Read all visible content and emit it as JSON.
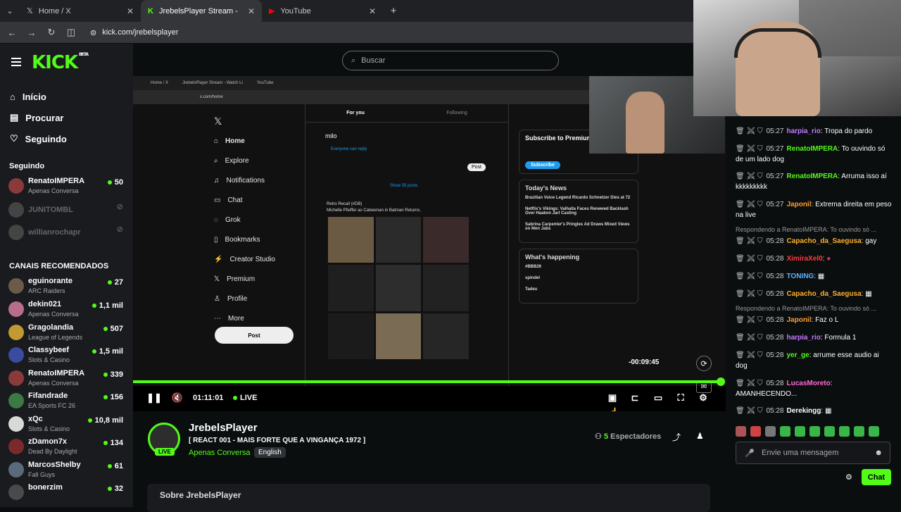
{
  "browser": {
    "tabs": [
      {
        "label": "Home / X",
        "icon": "x-logo-icon"
      },
      {
        "label": "JrebelsPlayer Stream - Watch Li",
        "icon": "kick-logo-icon"
      },
      {
        "label": "YouTube",
        "icon": "youtube-icon"
      }
    ],
    "url": "kick.com/jrebelsplayer"
  },
  "kick": {
    "logo": "KICK",
    "beta": "BETA",
    "search_placeholder": "Buscar",
    "nav": [
      {
        "label": "Início",
        "icon": "home-icon"
      },
      {
        "label": "Procurar",
        "icon": "browse-icon"
      },
      {
        "label": "Seguindo",
        "icon": "heart-icon"
      }
    ],
    "following_title": "Seguindo",
    "following": [
      {
        "name": "RenatoIMPERA",
        "category": "Apenas Conversa",
        "viewers": "50"
      },
      {
        "name": "JUNITOMBL",
        "category": "",
        "viewers": ""
      },
      {
        "name": "willianrochapr",
        "category": "",
        "viewers": ""
      }
    ],
    "recommended_title": "CANAIS RECOMENDADOS",
    "recommended": [
      {
        "name": "eguinorante",
        "category": "ARC Raiders",
        "viewers": "27"
      },
      {
        "name": "dekin021",
        "category": "Apenas Conversa",
        "viewers": "1,1 mil"
      },
      {
        "name": "Gragolandia",
        "category": "League of Legends",
        "viewers": "507"
      },
      {
        "name": "Classybeef",
        "category": "Slots & Casino",
        "viewers": "1,5 mil"
      },
      {
        "name": "RenatoIMPERA",
        "category": "Apenas Conversa",
        "viewers": "339"
      },
      {
        "name": "Fifandrade",
        "category": "EA Sports FC 26",
        "viewers": "156"
      },
      {
        "name": "xQc",
        "category": "Slots & Casino",
        "viewers": "10,8 mil"
      },
      {
        "name": "zDamon7x",
        "category": "Dead By Daylight",
        "viewers": "134"
      },
      {
        "name": "MarcosShelby",
        "category": "Fall Guys",
        "viewers": "61"
      },
      {
        "name": "bonerzim",
        "category": "",
        "viewers": "32"
      }
    ]
  },
  "stream_content": {
    "x_nav": [
      "Home",
      "Explore",
      "Notifications",
      "Chat",
      "Grok",
      "Bookmarks",
      "Creator Studio",
      "Premium",
      "Profile",
      "More"
    ],
    "x_post": "Post",
    "x_tabs": [
      "For you",
      "Following"
    ],
    "x_compose_user": "milo",
    "x_reply_setting": "Everyone can reply",
    "x_show_posts": "Show 35 posts",
    "x_tweet_author": "Retro Recall (#DB)",
    "x_tweet_text": "Michelle Pfeiffer as Catwoman in Batman Returns.",
    "x_subscribe_title": "Subscribe to Premium",
    "x_subscribe_btn": "Subscribe",
    "x_news_title": "Today's News",
    "x_news": [
      "Brazilian Voice Legend Ricardo Schnetzer Dies at 72",
      "Netflix's Vikings: Valhalla Faces Renewed Backlash Over Haakon Jarl Casting",
      "Sabrina Carpenter's Pringles Ad Draws Mixed Views on Men Jabs"
    ],
    "x_happening_title": "What's happening",
    "x_happening": [
      "#BBB26",
      "spindel",
      "Tadeu"
    ]
  },
  "player": {
    "time_left": "-00:09:45",
    "elapsed": "01:11:01",
    "live_label": "LIVE",
    "progress": 1.0
  },
  "stream_info": {
    "streamer": "JrebelsPlayer",
    "live_badge": "LIVE",
    "title": "[ REACT 001 - MAIS FORTE QUE A VINGANÇA 1972 ]",
    "category": "Apenas Conversa",
    "language": "English",
    "viewers_count": "5",
    "viewers_label": "Espectadores",
    "about": "Sobre JrebelsPlayer"
  },
  "chat": {
    "messages": [
      {
        "time": "05:27",
        "user": "harpia_rio",
        "color": "#c27cff",
        "text": "Tropa do pardo"
      },
      {
        "time": "05:27",
        "user": "RenatoIMPERA",
        "color": "#53fc18",
        "text": "To ouvindo só de um lado dog"
      },
      {
        "time": "05:27",
        "user": "RenatoIMPERA",
        "color": "#53fc18",
        "text": "Arruma isso aí kkkkkkkkk"
      },
      {
        "time": "05:27",
        "user": "Japonil",
        "color": "#ff9d2e",
        "text": "Extrema direita em peso na live"
      },
      {
        "time": "05:28",
        "user": "Capacho_da_Saegusa",
        "color": "#ffb02e",
        "text": "gay"
      },
      {
        "time": "05:28",
        "user": "XimiraXel0",
        "color": "#ff3b3b",
        "text": ""
      },
      {
        "time": "05:28",
        "user": "TONING",
        "color": "#5ab4ff",
        "text": ""
      },
      {
        "time": "05:28",
        "user": "Capacho_da_Saegusa",
        "color": "#ffb02e",
        "text": ""
      },
      {
        "time": "05:28",
        "user": "Japonil",
        "color": "#ff9d2e",
        "text": "Faz o L"
      },
      {
        "time": "05:28",
        "user": "harpia_rio",
        "color": "#c27cff",
        "text": "Formula 1"
      },
      {
        "time": "05:28",
        "user": "yer_ge",
        "color": "#53fc18",
        "text": "arrume esse audio ai dog"
      },
      {
        "time": "05:28",
        "user": "LucasMoreto",
        "color": "#ff6ad5",
        "text": "AMANHECENDO..."
      },
      {
        "time": "05:28",
        "user": "Derekingg",
        "color": "#ffffff",
        "text": ""
      }
    ],
    "reply_label": "Respondendo a RenatoIMPERA: To ouvindo só ...",
    "input_placeholder": "Envie uma mensagem",
    "send_label": "Chat"
  }
}
